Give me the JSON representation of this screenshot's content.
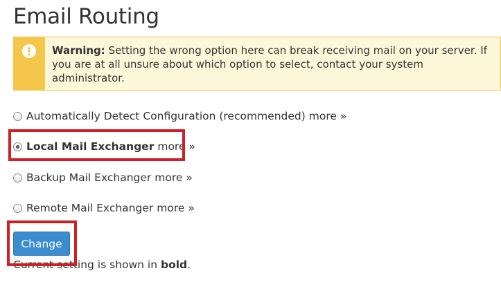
{
  "page": {
    "title": "Email Routing"
  },
  "warning": {
    "label": "Warning:",
    "message": "Setting the wrong option here can break receiving mail on your server. If you are at all unsure about which option to select, contact your system administrator.",
    "icon": "exclamation-circle-icon",
    "color_strip": "#f4c64a",
    "color_background": "#fdf7d9"
  },
  "routing_options": [
    {
      "label": "Automatically Detect Configuration (recommended)",
      "more": "more »",
      "selected": false,
      "bold": false
    },
    {
      "label": "Local Mail Exchanger",
      "more": "more »",
      "selected": true,
      "bold": true
    },
    {
      "label": "Backup Mail Exchanger",
      "more": "more »",
      "selected": false,
      "bold": false
    },
    {
      "label": "Remote Mail Exchanger",
      "more": "more »",
      "selected": false,
      "bold": false
    }
  ],
  "actions": {
    "change_label": "Change",
    "button_color": "#3c8dcf"
  },
  "note": {
    "prefix": "Current setting is shown in ",
    "bold_word": "bold",
    "suffix": "."
  },
  "highlight_color": "#d01e25"
}
